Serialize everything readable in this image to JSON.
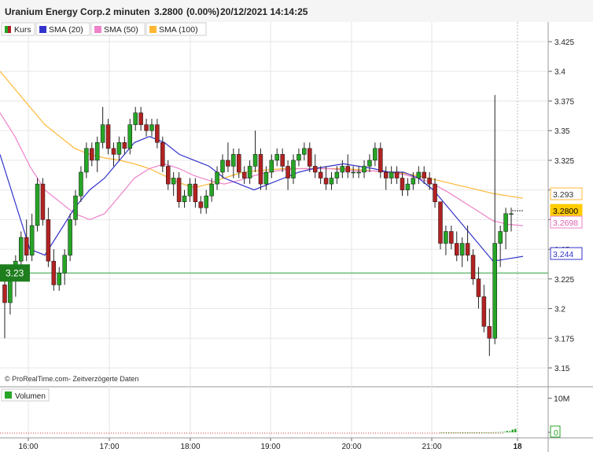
{
  "header": {
    "title": "Uranium Energy Corp.",
    "interval": "2 minuten",
    "price": "3.2800",
    "change": "(0.00%)",
    "datetime": "20/12/2021 14:14:25"
  },
  "legend": {
    "items": [
      {
        "label": "Kurs",
        "color": "#26a526"
      },
      {
        "label": "SMA (20)",
        "color": "#3333cc"
      },
      {
        "label": "SMA (50)",
        "color": "#ee82c8"
      },
      {
        "label": "SMA (100)",
        "color": "#ffb733"
      }
    ]
  },
  "watermark": "© ProRealTime.com- Zeitverzögerte Daten",
  "volume_legend": "Volumen",
  "level_line": {
    "label": "3.23",
    "value": 3.23,
    "color": "#2e9e3c"
  },
  "price_tags": [
    {
      "label": "3.293",
      "value": 3.293,
      "text_color": "#333333",
      "bg": "#ffffff",
      "border": "#ffb733"
    },
    {
      "label": "3.2800",
      "value": 3.28,
      "text_color": "#000000",
      "bg": "#ffcc00",
      "border": "#ffcc00"
    },
    {
      "label": "3.2698",
      "value": 3.2698,
      "text_color": "#e060b0",
      "bg": "#ffffff",
      "border": "#ee82c8"
    },
    {
      "label": "3.244",
      "value": 3.244,
      "text_color": "#3333cc",
      "bg": "#ffffff",
      "border": "#3333cc"
    }
  ],
  "volume_tags": [
    {
      "label": "10M"
    },
    {
      "label": "0"
    }
  ],
  "colors": {
    "up": "#26a526",
    "down": "#b22222",
    "wick": "#222222",
    "grid": "#e6e6e6",
    "volume": "#26a526"
  },
  "chart_data": {
    "type": "candlestick",
    "x_tick_labels": [
      "16:00",
      "17:00",
      "18:00",
      "19:00",
      "20:00",
      "21:00",
      "18"
    ],
    "y_tick_labels": [
      "3.425",
      "3.4",
      "3.375",
      "3.35",
      "3.325",
      "3.3",
      "3.275",
      "3.25",
      "3.225",
      "3.2",
      "3.175",
      "3.15"
    ],
    "ylim": [
      3.14,
      3.44
    ],
    "volume_ticks": [
      "10M",
      "0"
    ],
    "candles": [
      [
        3.22,
        3.225,
        3.175,
        3.205
      ],
      [
        3.205,
        3.235,
        3.195,
        3.225
      ],
      [
        3.225,
        3.245,
        3.21,
        3.24
      ],
      [
        3.24,
        3.265,
        3.235,
        3.26
      ],
      [
        3.26,
        3.275,
        3.24,
        3.245
      ],
      [
        3.245,
        3.28,
        3.24,
        3.27
      ],
      [
        3.27,
        3.31,
        3.265,
        3.305
      ],
      [
        3.305,
        3.31,
        3.27,
        3.275
      ],
      [
        3.275,
        3.285,
        3.235,
        3.24
      ],
      [
        3.24,
        3.25,
        3.215,
        3.22
      ],
      [
        3.22,
        3.235,
        3.215,
        3.23
      ],
      [
        3.23,
        3.25,
        3.22,
        3.245
      ],
      [
        3.245,
        3.28,
        3.24,
        3.275
      ],
      [
        3.275,
        3.3,
        3.27,
        3.295
      ],
      [
        3.295,
        3.32,
        3.29,
        3.315
      ],
      [
        3.315,
        3.34,
        3.31,
        3.335
      ],
      [
        3.335,
        3.34,
        3.32,
        3.325
      ],
      [
        3.325,
        3.345,
        3.315,
        3.34
      ],
      [
        3.34,
        3.37,
        3.335,
        3.355
      ],
      [
        3.355,
        3.36,
        3.33,
        3.335
      ],
      [
        3.335,
        3.34,
        3.32,
        3.33
      ],
      [
        3.33,
        3.345,
        3.325,
        3.34
      ],
      [
        3.34,
        3.345,
        3.33,
        3.335
      ],
      [
        3.335,
        3.36,
        3.33,
        3.355
      ],
      [
        3.355,
        3.37,
        3.35,
        3.365
      ],
      [
        3.365,
        3.37,
        3.35,
        3.355
      ],
      [
        3.355,
        3.36,
        3.345,
        3.35
      ],
      [
        3.35,
        3.36,
        3.345,
        3.355
      ],
      [
        3.355,
        3.36,
        3.335,
        3.34
      ],
      [
        3.34,
        3.345,
        3.315,
        3.32
      ],
      [
        3.32,
        3.325,
        3.3,
        3.305
      ],
      [
        3.305,
        3.315,
        3.295,
        3.31
      ],
      [
        3.31,
        3.315,
        3.285,
        3.29
      ],
      [
        3.29,
        3.3,
        3.285,
        3.295
      ],
      [
        3.295,
        3.31,
        3.29,
        3.305
      ],
      [
        3.305,
        3.31,
        3.285,
        3.29
      ],
      [
        3.29,
        3.295,
        3.28,
        3.285
      ],
      [
        3.285,
        3.3,
        3.28,
        3.295
      ],
      [
        3.295,
        3.31,
        3.29,
        3.305
      ],
      [
        3.305,
        3.32,
        3.3,
        3.315
      ],
      [
        3.315,
        3.33,
        3.31,
        3.325
      ],
      [
        3.325,
        3.34,
        3.315,
        3.32
      ],
      [
        3.32,
        3.335,
        3.31,
        3.33
      ],
      [
        3.33,
        3.335,
        3.31,
        3.315
      ],
      [
        3.315,
        3.32,
        3.305,
        3.31
      ],
      [
        3.31,
        3.325,
        3.305,
        3.32
      ],
      [
        3.32,
        3.35,
        3.315,
        3.33
      ],
      [
        3.33,
        3.335,
        3.3,
        3.305
      ],
      [
        3.305,
        3.32,
        3.3,
        3.315
      ],
      [
        3.315,
        3.33,
        3.31,
        3.325
      ],
      [
        3.325,
        3.335,
        3.32,
        3.33
      ],
      [
        3.33,
        3.335,
        3.315,
        3.32
      ],
      [
        3.32,
        3.325,
        3.3,
        3.31
      ],
      [
        3.31,
        3.33,
        3.305,
        3.325
      ],
      [
        3.325,
        3.335,
        3.32,
        3.33
      ],
      [
        3.33,
        3.34,
        3.325,
        3.335
      ],
      [
        3.335,
        3.34,
        3.315,
        3.32
      ],
      [
        3.32,
        3.33,
        3.31,
        3.315
      ],
      [
        3.315,
        3.32,
        3.305,
        3.31
      ],
      [
        3.31,
        3.32,
        3.3,
        3.305
      ],
      [
        3.305,
        3.315,
        3.3,
        3.31
      ],
      [
        3.31,
        3.32,
        3.305,
        3.315
      ],
      [
        3.315,
        3.325,
        3.31,
        3.32
      ],
      [
        3.32,
        3.33,
        3.31,
        3.315
      ],
      [
        3.315,
        3.32,
        3.31,
        3.315
      ],
      [
        3.315,
        3.32,
        3.31,
        3.315
      ],
      [
        3.315,
        3.325,
        3.31,
        3.32
      ],
      [
        3.32,
        3.33,
        3.315,
        3.325
      ],
      [
        3.325,
        3.34,
        3.32,
        3.335
      ],
      [
        3.335,
        3.34,
        3.31,
        3.315
      ],
      [
        3.315,
        3.32,
        3.3,
        3.31
      ],
      [
        3.31,
        3.32,
        3.305,
        3.315
      ],
      [
        3.315,
        3.32,
        3.305,
        3.31
      ],
      [
        3.31,
        3.315,
        3.295,
        3.3
      ],
      [
        3.3,
        3.31,
        3.295,
        3.305
      ],
      [
        3.305,
        3.315,
        3.3,
        3.31
      ],
      [
        3.31,
        3.32,
        3.305,
        3.315
      ],
      [
        3.315,
        3.32,
        3.305,
        3.31
      ],
      [
        3.31,
        3.315,
        3.3,
        3.305
      ],
      [
        3.305,
        3.31,
        3.285,
        3.29
      ],
      [
        3.29,
        3.27,
        3.25,
        3.255
      ],
      [
        3.255,
        3.27,
        3.245,
        3.265
      ],
      [
        3.265,
        3.27,
        3.25,
        3.255
      ],
      [
        3.255,
        3.265,
        3.24,
        3.245
      ],
      [
        3.245,
        3.26,
        3.235,
        3.255
      ],
      [
        3.255,
        3.27,
        3.24,
        3.245
      ],
      [
        3.245,
        3.25,
        3.22,
        3.225
      ],
      [
        3.225,
        3.235,
        3.2,
        3.21
      ],
      [
        3.21,
        3.22,
        3.18,
        3.185
      ],
      [
        3.185,
        3.2,
        3.16,
        3.175
      ],
      [
        3.175,
        3.38,
        3.17,
        3.255
      ],
      [
        3.255,
        3.27,
        3.235,
        3.265
      ],
      [
        3.265,
        3.285,
        3.25,
        3.28
      ],
      [
        3.28,
        3.285,
        3.265,
        3.28
      ]
    ],
    "sma20": [
      3.33,
      3.29,
      3.25,
      3.245,
      3.265,
      3.285,
      3.3,
      3.31,
      3.325,
      3.34,
      3.345,
      3.34,
      3.33,
      3.325,
      3.32,
      3.31,
      3.305,
      3.3,
      3.305,
      3.31,
      3.315,
      3.318,
      3.32,
      3.322,
      3.32,
      3.318,
      3.315,
      3.315,
      3.31,
      3.3,
      3.285,
      3.27,
      3.255,
      3.24,
      3.242,
      3.244
    ],
    "sma50": [
      3.365,
      3.345,
      3.32,
      3.3,
      3.29,
      3.28,
      3.275,
      3.28,
      3.295,
      3.31,
      3.318,
      3.322,
      3.318,
      3.312,
      3.308,
      3.305,
      3.308,
      3.312,
      3.315,
      3.317,
      3.318,
      3.318,
      3.318,
      3.317,
      3.316,
      3.316,
      3.315,
      3.313,
      3.31,
      3.305,
      3.298,
      3.29,
      3.282,
      3.274,
      3.271,
      3.2698
    ],
    "sma100": [
      3.4,
      3.385,
      3.37,
      3.355,
      3.345,
      3.335,
      3.33,
      3.327,
      3.325,
      3.322,
      3.318,
      3.312,
      3.306,
      3.302,
      3.305,
      3.31,
      3.314,
      3.316,
      3.317,
      3.318,
      3.318,
      3.318,
      3.318,
      3.318,
      3.317,
      3.316,
      3.315,
      3.314,
      3.312,
      3.309,
      3.306,
      3.303,
      3.3,
      3.297,
      3.295,
      3.293
    ],
    "volume": [
      0.02,
      0.02,
      0.01,
      0.02,
      0.02,
      0.01,
      0.02,
      0.02,
      0.01,
      0.02,
      0.01,
      0.02,
      0.02,
      0.01,
      0.02,
      0.02,
      0.03,
      0.02,
      0.02,
      0.04,
      0.05,
      0.06,
      0.08,
      0.15,
      0.4,
      0.3,
      0.8,
      1.0
    ],
    "volume_max": 12
  }
}
